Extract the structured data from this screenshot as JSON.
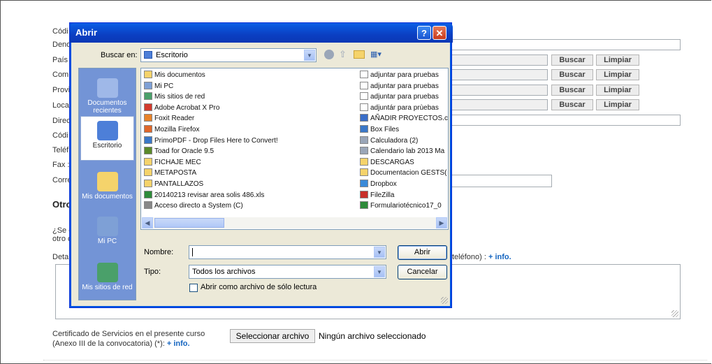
{
  "form": {
    "labels": {
      "codigo_top": "Códi",
      "denominacion": "Deno",
      "pais": "País",
      "comunidad": "Com",
      "provincia": "Provi",
      "localidad": "Loca",
      "direccion": "Direc",
      "codigo_postal": "Códi",
      "telefono": "Teléf",
      "fax": "Fax :",
      "correo": "Corre",
      "otro_section": "Otro",
      "se_question_1": "¿Se e",
      "se_question_2": "otro c",
      "detalle": "Detal"
    },
    "buttons": {
      "buscar": "Buscar",
      "limpiar": "Limpiar"
    },
    "detalle_suffix": "teléfono) : ",
    "info_link": "+ info.",
    "certificado_line1": "Certificado de Servicios en el presente curso",
    "certificado_line2": "(Anexo III de la convocatoria) (*): ",
    "file_button": "Seleccionar archivo",
    "file_status": "Ningún archivo seleccionado"
  },
  "dialog": {
    "title": "Abrir",
    "help_glyph": "?",
    "close_glyph": "✕",
    "lookin_label": "Buscar en:",
    "lookin_value": "Escritorio",
    "places": [
      {
        "label": "Documentos recientes",
        "color": "#9fb8e8"
      },
      {
        "label": "Escritorio",
        "color": "#4d7fd8"
      },
      {
        "label": "Mis documentos",
        "color": "#f5d36b"
      },
      {
        "label": "Mi PC",
        "color": "#7ea0d6"
      },
      {
        "label": "Mis sitios de red",
        "color": "#4aa06a"
      }
    ],
    "files_left": [
      {
        "name": "Mis documentos",
        "color": "#f5d36b"
      },
      {
        "name": "Mi PC",
        "color": "#7ea0d6"
      },
      {
        "name": "Mis sitios de red",
        "color": "#4aa06a"
      },
      {
        "name": "Adobe Acrobat X Pro",
        "color": "#d23b2e"
      },
      {
        "name": "Foxit Reader",
        "color": "#e8832a"
      },
      {
        "name": "Mozilla Firefox",
        "color": "#e0672a"
      },
      {
        "name": "PrimoPDF - Drop Files Here to Convert!",
        "color": "#3a78c8"
      },
      {
        "name": "Toad for Oracle 9.5",
        "color": "#5a8a2a"
      },
      {
        "name": "FICHAJE MEC",
        "color": "#f5d36b"
      },
      {
        "name": "METAPOSTA",
        "color": "#f5d36b"
      },
      {
        "name": "PANTALLAZOS",
        "color": "#f5d36b"
      },
      {
        "name": "20140213 revisar area solis 486.xls",
        "color": "#2e8b3a"
      },
      {
        "name": "Acceso directo a System (C)",
        "color": "#888888"
      }
    ],
    "files_right": [
      {
        "name": "adjuntar para pruebas",
        "color": "#ffffff"
      },
      {
        "name": "adjuntar para pruebas",
        "color": "#ffffff"
      },
      {
        "name": "adjuntar para pruebas",
        "color": "#ffffff"
      },
      {
        "name": "adjuntár para prùebas",
        "color": "#ffffff"
      },
      {
        "name": "AÑADIR PROYECTOS.c",
        "color": "#3a6ec8"
      },
      {
        "name": "Box Files",
        "color": "#3a78c8"
      },
      {
        "name": "Calculadora (2)",
        "color": "#9aa6b8"
      },
      {
        "name": "Calendario lab 2013 Ma",
        "color": "#9aa6b8"
      },
      {
        "name": "DESCARGAS",
        "color": "#f5d36b"
      },
      {
        "name": "Documentacion GESTS(",
        "color": "#f5d36b"
      },
      {
        "name": "Dropbox",
        "color": "#3a8ad8"
      },
      {
        "name": "FileZilla",
        "color": "#c8302a"
      },
      {
        "name": "Formulariotécnico17_0",
        "color": "#2e8b3a"
      }
    ],
    "nombre_label": "Nombre:",
    "nombre_value": "",
    "tipo_label": "Tipo:",
    "tipo_value": "Todos los archivos",
    "readonly_label": "Abrir como archivo de sólo lectura",
    "abrir_button": "Abrir",
    "cancelar_button": "Cancelar"
  }
}
